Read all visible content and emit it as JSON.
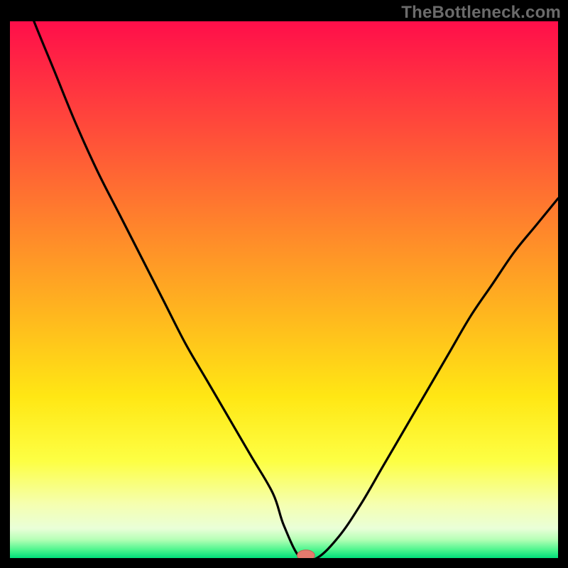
{
  "watermark": "TheBottleneck.com",
  "colors": {
    "frame": "#000000",
    "gradient_stops": [
      {
        "offset": 0.0,
        "color": "#ff0e4a"
      },
      {
        "offset": 0.2,
        "color": "#ff4b3a"
      },
      {
        "offset": 0.4,
        "color": "#ff8a2a"
      },
      {
        "offset": 0.55,
        "color": "#ffb81e"
      },
      {
        "offset": 0.7,
        "color": "#ffe714"
      },
      {
        "offset": 0.82,
        "color": "#fdff44"
      },
      {
        "offset": 0.9,
        "color": "#f5ffb0"
      },
      {
        "offset": 0.945,
        "color": "#e9ffd8"
      },
      {
        "offset": 0.965,
        "color": "#b7ffb7"
      },
      {
        "offset": 0.985,
        "color": "#4bf58d"
      },
      {
        "offset": 1.0,
        "color": "#00e07a"
      }
    ],
    "curve": "#000000",
    "marker_fill": "#e47a6d",
    "marker_stroke": "#c65b52"
  },
  "chart_data": {
    "type": "line",
    "title": "",
    "xlabel": "",
    "ylabel": "",
    "xlim": [
      0,
      100
    ],
    "ylim": [
      0,
      100
    ],
    "notch": {
      "x": 53,
      "y": 0
    },
    "marker": {
      "x": 54,
      "y": 0.5,
      "rx": 1.6,
      "ry": 1.0
    },
    "series": [
      {
        "name": "bottleneck-curve",
        "x": [
          0,
          4,
          8,
          12,
          16,
          20,
          24,
          28,
          32,
          36,
          40,
          44,
          48,
          50,
          53,
          56,
          60,
          64,
          68,
          72,
          76,
          80,
          84,
          88,
          92,
          96,
          100
        ],
        "y": [
          112,
          101,
          91,
          81,
          72,
          64,
          56,
          48,
          40,
          33,
          26,
          19,
          12,
          6,
          0,
          0,
          4,
          10,
          17,
          24,
          31,
          38,
          45,
          51,
          57,
          62,
          67
        ]
      }
    ]
  }
}
